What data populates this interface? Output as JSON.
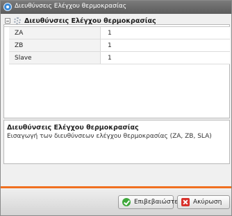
{
  "window": {
    "title": "Διευθύνσεις Ελέγχου θερμοκρασίας",
    "title_icon": "app-logo-icon"
  },
  "grid": {
    "category_title": "Διευθύνσεις Ελέγχου θερμοκρασίας",
    "rows": [
      {
        "name": "ZA",
        "value": "1"
      },
      {
        "name": "ZB",
        "value": "1"
      },
      {
        "name": "Slave",
        "value": "1"
      }
    ]
  },
  "description": {
    "title": "Διευθύνσεις Ελέγχου θερμοκρασίας",
    "text": "Εισαγωγή των διευθύνσεων ελέγχου θερμοκρασίας (ZA, ZB, SLA)"
  },
  "buttons": {
    "ok_label": "Επιβεβαιώστε",
    "cancel_label": "Ακύρωση"
  },
  "colors": {
    "accent": "#f07020",
    "titlebar": "#666666",
    "ok_icon": "#3ea83a",
    "cancel_icon": "#d8302a"
  }
}
